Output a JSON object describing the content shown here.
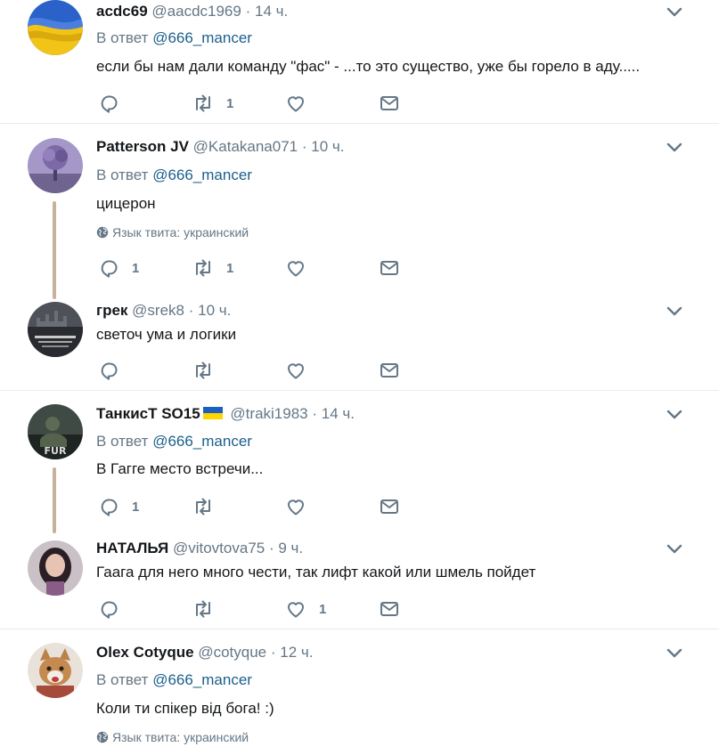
{
  "tweets": [
    {
      "name": "acdc69",
      "handle": "@aacdc1969",
      "sep": "·",
      "time": "14 ч.",
      "reply_label": "В ответ",
      "reply_to": "@666_mancer",
      "text": "если бы нам дали команду \"фас\" - ...то это существо, уже бы горело в аду.....",
      "replies": "",
      "retweets": "1",
      "likes": ""
    },
    {
      "name": "Patterson JV",
      "handle": "@Katakana071",
      "sep": "·",
      "time": "10 ч.",
      "reply_label": "В ответ",
      "reply_to": "@666_mancer",
      "text": "цицерон",
      "lang": "Язык твита: украинский",
      "replies": "1",
      "retweets": "1",
      "likes": ""
    },
    {
      "name": "грек",
      "handle": "@srek8",
      "sep": "·",
      "time": "10 ч.",
      "text": "светоч  ума и логики",
      "replies": "",
      "retweets": "",
      "likes": ""
    },
    {
      "name": "ТанкисТ SO15",
      "handle": "@traki1983",
      "sep": "·",
      "time": "14 ч.",
      "reply_label": "В ответ",
      "reply_to": "@666_mancer",
      "text": "В Гагге место встречи...",
      "replies": "1",
      "retweets": "",
      "likes": ""
    },
    {
      "name": "НАТАЛЬЯ",
      "handle": "@vitovtova75",
      "sep": "·",
      "time": "9 ч.",
      "text": "Гаага для него много чести, так лифт какой или шмель пойдет",
      "replies": "",
      "retweets": "",
      "likes": "1"
    },
    {
      "name": "Olex Cotyque",
      "handle": "@cotyque",
      "sep": "·",
      "time": "12 ч.",
      "reply_label": "В ответ",
      "reply_to": "@666_mancer",
      "text": "Коли ти спікер від бога! :)",
      "lang": "Язык твита: украинский"
    }
  ],
  "colors": {
    "text": "#14171a",
    "muted": "#657786",
    "mention": "#1b5f8c",
    "divider": "#e6ecf0",
    "thread_line": "#c7b299",
    "flag_blue": "#1d5fbf",
    "flag_yellow": "#ffd500"
  },
  "icons": [
    "reply-icon",
    "retweet-icon",
    "like-icon",
    "direct-message-icon",
    "chevron-down-icon",
    "globe-icon",
    "ukraine-flag-icon"
  ]
}
